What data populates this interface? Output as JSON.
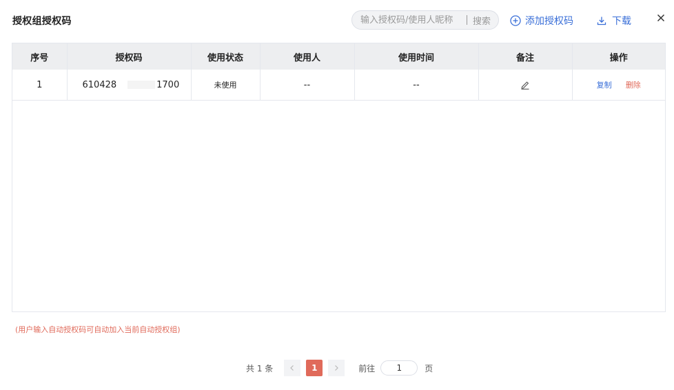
{
  "header": {
    "title": "授权组授权码",
    "search_placeholder": "输入授权码/使用人昵称",
    "search_button": "搜索",
    "add_label": "添加授权码",
    "download_label": "下载"
  },
  "table": {
    "columns": [
      "序号",
      "授权码",
      "使用状态",
      "使用人",
      "使用时间",
      "备注",
      "操作"
    ],
    "rows": [
      {
        "index": "1",
        "code_prefix": "610428",
        "code_suffix": "1700",
        "status": "未使用",
        "user": "--",
        "time": "--",
        "copy_label": "复制",
        "delete_label": "删除"
      }
    ]
  },
  "hint": "(用户输入自动授权码可自动加入当前自动授权组)",
  "pagination": {
    "total_text": "共 1 条",
    "current_page": "1",
    "goto_label": "前往",
    "goto_value": "1",
    "page_suffix": "页"
  },
  "colors": {
    "accent": "#3a6fd8",
    "danger": "#e06a5a",
    "header_bg": "#edeef0"
  }
}
